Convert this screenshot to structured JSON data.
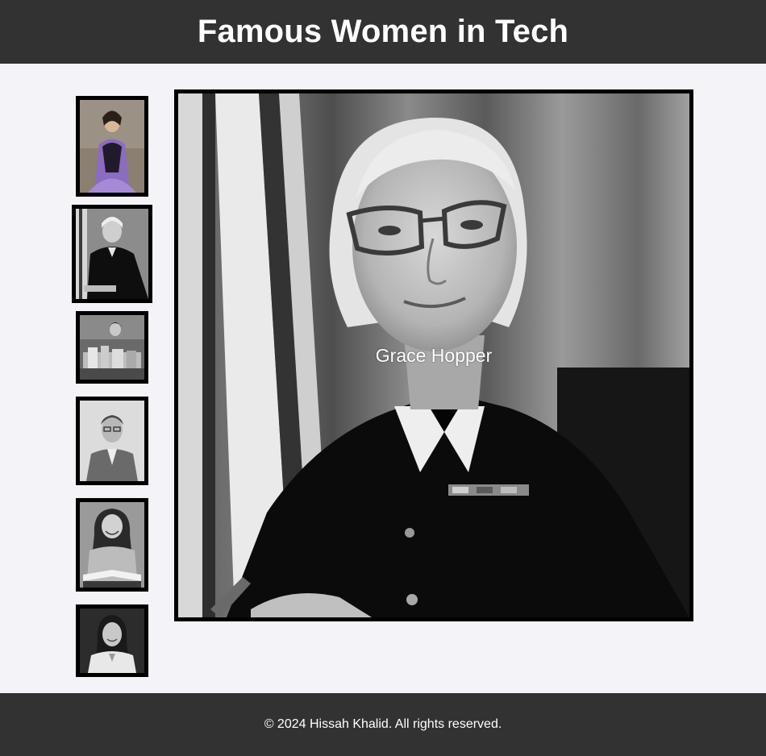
{
  "header": {
    "title": "Famous Women in Tech"
  },
  "gallery": {
    "selected_caption": "Grace Hopper",
    "thumbnails": [
      {
        "icon": "portrait-painting-thumbnail"
      },
      {
        "icon": "portrait-naval-uniform-thumbnail"
      },
      {
        "icon": "portrait-woman-with-equipment-thumbnail"
      },
      {
        "icon": "portrait-woman-with-glasses-thumbnail"
      },
      {
        "icon": "portrait-woman-with-book-thumbnail"
      },
      {
        "icon": "portrait-woman-smiling-thumbnail"
      }
    ]
  },
  "footer": {
    "text": "© 2024 Hissah Khalid. All rights reserved."
  }
}
